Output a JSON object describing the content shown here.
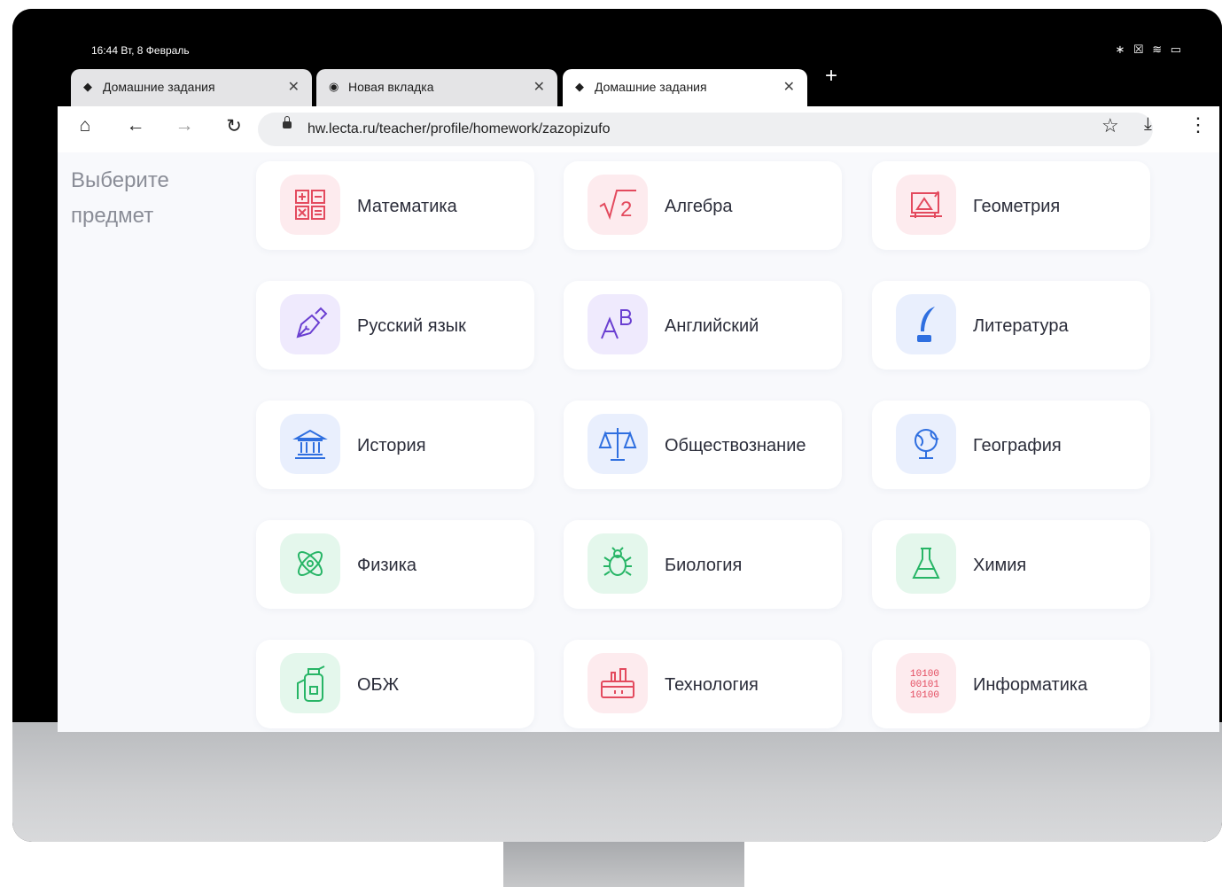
{
  "status": {
    "time": "16:44 Вт, 8 Февраль",
    "icons": "∗ ☒ ≋ ▭"
  },
  "tabs": [
    {
      "title": "Домашние задания",
      "active": false
    },
    {
      "title": "Новая вкладка",
      "active": false
    },
    {
      "title": "Домашние задания",
      "active": true
    }
  ],
  "toolbar": {
    "url": "hw.lecta.ru/teacher/profile/homework/zazopizufo"
  },
  "page": {
    "heading": "Выберите предмет"
  },
  "subjects": [
    {
      "label": "Математика",
      "icon": "calculator-grid-icon",
      "color": "#e34a5e"
    },
    {
      "label": "Алгебра",
      "icon": "square-root-icon",
      "color": "#e34a5e"
    },
    {
      "label": "Геометрия",
      "icon": "geometry-board-icon",
      "color": "#e34a5e"
    },
    {
      "label": "Русский язык",
      "icon": "pen-nib-icon",
      "color": "#6a3fd1"
    },
    {
      "label": "Английский",
      "icon": "letters-ab-icon",
      "color": "#6a3fd1"
    },
    {
      "label": "Литература",
      "icon": "quill-inkwell-icon",
      "color": "#2f6fe0"
    },
    {
      "label": "История",
      "icon": "museum-building-icon",
      "color": "#2f6fe0"
    },
    {
      "label": "Обществознание",
      "icon": "scales-icon",
      "color": "#2f6fe0"
    },
    {
      "label": "География",
      "icon": "globe-icon",
      "color": "#2f6fe0"
    },
    {
      "label": "Физика",
      "icon": "atom-icon",
      "color": "#27b566"
    },
    {
      "label": "Биология",
      "icon": "bug-icon",
      "color": "#27b566"
    },
    {
      "label": "Химия",
      "icon": "flask-icon",
      "color": "#27b566"
    },
    {
      "label": "ОБЖ",
      "icon": "fire-extinguisher-icon",
      "color": "#27b566"
    },
    {
      "label": "Технология",
      "icon": "toolbox-icon",
      "color": "#e34a5e"
    },
    {
      "label": "Информатика",
      "icon": "binary-code-icon",
      "color": "#e34a5e"
    }
  ]
}
